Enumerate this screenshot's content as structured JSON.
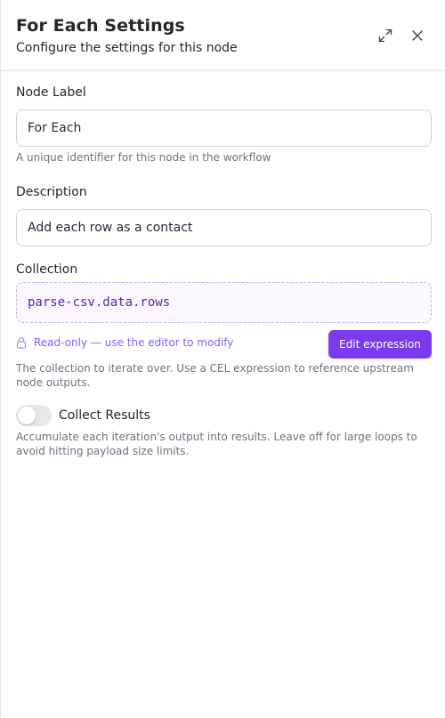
{
  "header": {
    "title": "For Each Settings",
    "subtitle": "Configure the settings for this node",
    "expand_icon": "expand-arrows-icon",
    "close_icon": "close-icon"
  },
  "node_label": {
    "label": "Node Label",
    "value": "For Each",
    "help": "A unique identifier for this node in the workflow"
  },
  "description": {
    "label": "Description",
    "value": "Add each row as a contact"
  },
  "collection": {
    "label": "Collection",
    "expression": "parse-csv.data.rows",
    "readonly_note": "Read-only — use the editor to modify",
    "edit_button": "Edit expression",
    "help": "The collection to iterate over. Use a CEL expression to reference upstream node outputs."
  },
  "collect_results": {
    "label": "Collect Results",
    "enabled": false,
    "help": "Accumulate each iteration's output into results. Leave off for large loops to avoid hitting payload size limits."
  },
  "colors": {
    "accent": "#7c3aed",
    "expression_text": "#5b21b6",
    "muted_text": "#6b7280"
  }
}
